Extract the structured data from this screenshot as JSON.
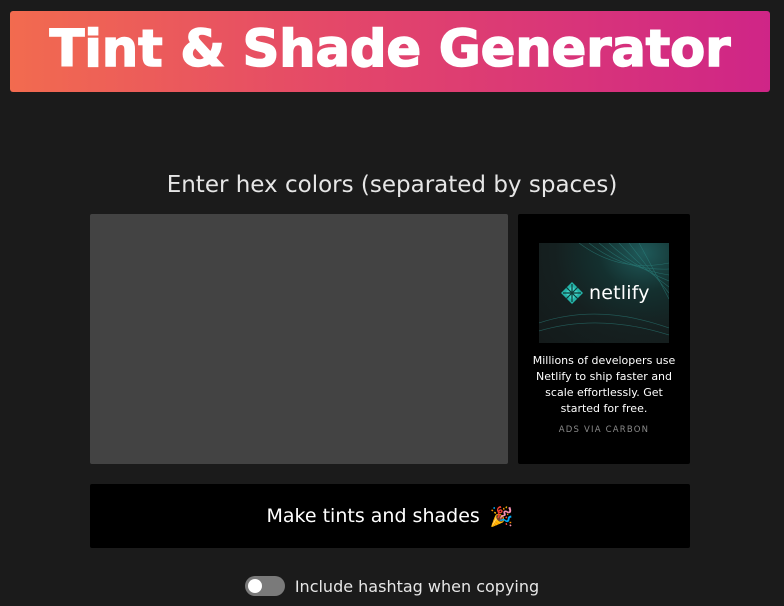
{
  "header": {
    "title": "Tint & Shade Generator"
  },
  "colors": {
    "gradient_start": "#f26b4f",
    "gradient_end": "#cf2587",
    "page_bg": "#1b1b1b",
    "input_bg": "#434343"
  },
  "input": {
    "prompt": "Enter hex colors (separated by spaces)",
    "value": "",
    "placeholder": ""
  },
  "ad": {
    "brand": "netlify",
    "logo_icon": "netlify-diamond-icon",
    "text": "Millions of developers use Netlify to ship faster and scale effortlessly. Get started for free.",
    "via": "ADS VIA CARBON"
  },
  "actions": {
    "make_label": "Make tints and shades",
    "make_icon": "party-popper-icon",
    "make_emoji": "🎉"
  },
  "options": {
    "hashtag_label": "Include hashtag when copying",
    "hashtag_enabled": false
  }
}
